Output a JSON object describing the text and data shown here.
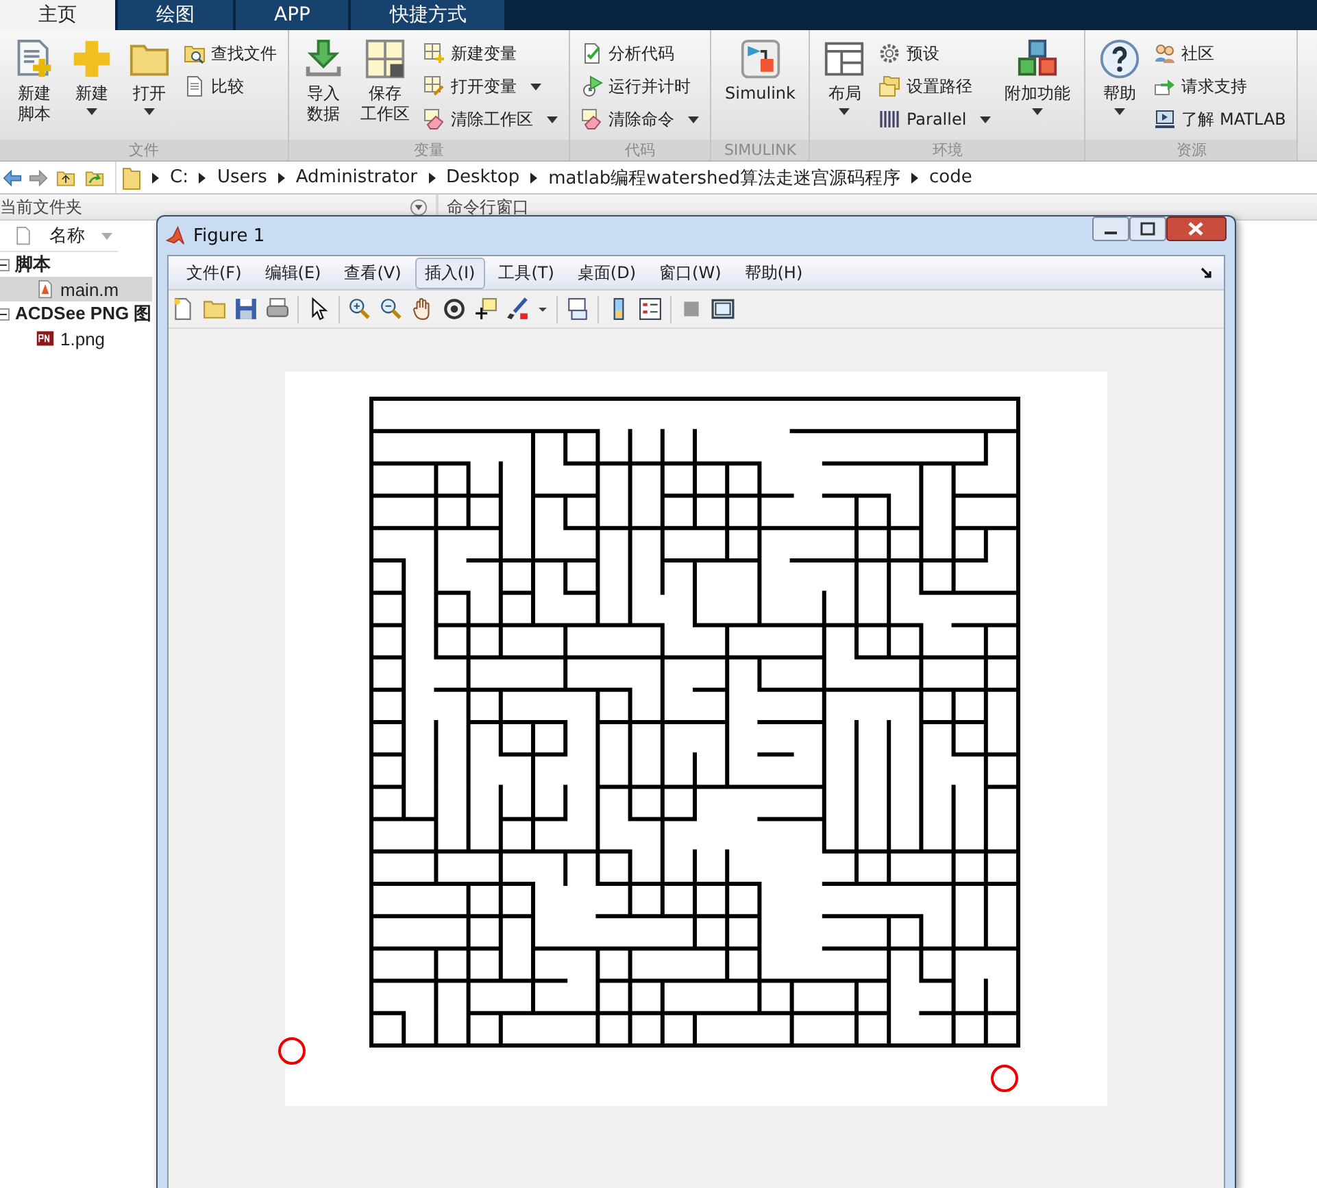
{
  "tabs": [
    {
      "label": "主页",
      "selected": true
    },
    {
      "label": "绘图",
      "selected": false
    },
    {
      "label": "APP",
      "selected": false
    },
    {
      "label": "快捷方式",
      "selected": false
    }
  ],
  "ribbon": {
    "groups": [
      {
        "label": "文件",
        "items": [
          {
            "kind": "large",
            "lines": [
              "新建",
              "脚本"
            ],
            "dropdown": false
          },
          {
            "kind": "large",
            "lines": [
              "新建"
            ],
            "dropdown": true
          },
          {
            "kind": "large",
            "lines": [
              "打开"
            ],
            "dropdown": true
          },
          {
            "kind": "column",
            "items": [
              {
                "label": "查找文件",
                "dropdown": false
              },
              {
                "label": "比较",
                "dropdown": false
              }
            ]
          }
        ]
      },
      {
        "label": "变量",
        "items": [
          {
            "kind": "large",
            "lines": [
              "导入",
              "数据"
            ],
            "dropdown": false
          },
          {
            "kind": "large",
            "lines": [
              "保存",
              "工作区"
            ],
            "dropdown": false
          },
          {
            "kind": "column",
            "items": [
              {
                "label": "新建变量",
                "dropdown": false
              },
              {
                "label": "打开变量",
                "dropdown": true
              },
              {
                "label": "清除工作区",
                "dropdown": true
              }
            ]
          }
        ]
      },
      {
        "label": "代码",
        "items": [
          {
            "kind": "column",
            "items": [
              {
                "label": "分析代码",
                "dropdown": false
              },
              {
                "label": "运行并计时",
                "dropdown": false
              },
              {
                "label": "清除命令",
                "dropdown": true
              }
            ]
          }
        ]
      },
      {
        "label": "SIMULINK",
        "items": [
          {
            "kind": "large",
            "lines": [
              "Simulink"
            ],
            "dropdown": false
          }
        ]
      },
      {
        "label": "环境",
        "items": [
          {
            "kind": "large",
            "lines": [
              "布局"
            ],
            "dropdown": true
          },
          {
            "kind": "column",
            "items": [
              {
                "label": "预设",
                "dropdown": false
              },
              {
                "label": "设置路径",
                "dropdown": false
              },
              {
                "label": "Parallel",
                "dropdown": true
              }
            ]
          },
          {
            "kind": "large",
            "lines": [
              "附加功能"
            ],
            "dropdown": true
          }
        ]
      },
      {
        "label": "资源",
        "items": [
          {
            "kind": "large",
            "lines": [
              "帮助"
            ],
            "dropdown": true
          },
          {
            "kind": "column",
            "items": [
              {
                "label": "社区",
                "dropdown": false
              },
              {
                "label": "请求支持",
                "dropdown": false
              },
              {
                "label": "了解 MATLAB",
                "dropdown": false
              }
            ]
          }
        ]
      }
    ]
  },
  "address": {
    "path": [
      "C:",
      "Users",
      "Administrator",
      "Desktop",
      "matlab编程watershed算法走迷宫源码程序",
      "code"
    ]
  },
  "file_panel": {
    "title": "当前文件夹",
    "column": "名称",
    "tree": [
      {
        "label": "脚本",
        "expanded": true,
        "selected": false,
        "children": [
          {
            "label": "main.m",
            "selected": true
          }
        ]
      },
      {
        "label": "ACDSee PNG 图",
        "expanded": true,
        "selected": false,
        "children": [
          {
            "label": "1.png",
            "selected": false
          }
        ]
      }
    ]
  },
  "command_panel": {
    "title": "命令行窗口"
  },
  "figure": {
    "title": "Figure 1",
    "menu": [
      {
        "label": "文件(F)",
        "selected": false
      },
      {
        "label": "编辑(E)",
        "selected": false
      },
      {
        "label": "查看(V)",
        "selected": false
      },
      {
        "label": "插入(I)",
        "selected": true
      },
      {
        "label": "工具(T)",
        "selected": false
      },
      {
        "label": "桌面(D)",
        "selected": false
      },
      {
        "label": "窗口(W)",
        "selected": false
      },
      {
        "label": "帮助(H)",
        "selected": false
      }
    ]
  }
}
